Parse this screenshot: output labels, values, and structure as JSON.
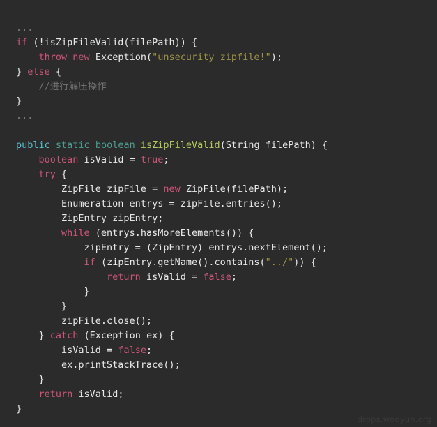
{
  "viewer": {
    "background_color": "#2b2b2b",
    "watermark": "drops.wooyun.org"
  },
  "theme": {
    "foreground": "#e8e8e8",
    "keyword": "#cc5577",
    "modifier_public": "#5bbfd0",
    "modifier_static": "#4d9e92",
    "type_keyword": "#4d9e92",
    "function_name": "#b5cc5f",
    "string": "#9e9246",
    "comment": "#6f6f6f"
  },
  "code": {
    "language": "java",
    "lines": [
      {
        "id": "l1",
        "text": "..."
      },
      {
        "id": "l2",
        "text": "if (!isZipFileValid(filePath)) {"
      },
      {
        "id": "l3",
        "text": "    throw new Exception(\"unsecurity zipfile!\");"
      },
      {
        "id": "l4",
        "text": "} else {"
      },
      {
        "id": "l5",
        "text": "    //进行解压操作"
      },
      {
        "id": "l6",
        "text": "}"
      },
      {
        "id": "l7",
        "text": "..."
      },
      {
        "id": "l8",
        "text": ""
      },
      {
        "id": "l9",
        "text": "public static boolean isZipFileValid(String filePath) {"
      },
      {
        "id": "l10",
        "text": "    boolean isValid = true;"
      },
      {
        "id": "l11",
        "text": "    try {"
      },
      {
        "id": "l12",
        "text": "        ZipFile zipFile = new ZipFile(filePath);"
      },
      {
        "id": "l13",
        "text": "        Enumeration entrys = zipFile.entries();"
      },
      {
        "id": "l14",
        "text": "        ZipEntry zipEntry;"
      },
      {
        "id": "l15",
        "text": "        while (entrys.hasMoreElements()) {"
      },
      {
        "id": "l16",
        "text": "            zipEntry = (ZipEntry) entrys.nextElement();"
      },
      {
        "id": "l17",
        "text": "            if (zipEntry.getName().contains(\"../\")) {"
      },
      {
        "id": "l18",
        "text": "                return isValid = false;"
      },
      {
        "id": "l19",
        "text": "            }"
      },
      {
        "id": "l20",
        "text": "        }"
      },
      {
        "id": "l21",
        "text": "        zipFile.close();"
      },
      {
        "id": "l22",
        "text": "    } catch (Exception ex) {"
      },
      {
        "id": "l23",
        "text": "        isValid = false;"
      },
      {
        "id": "l24",
        "text": "        ex.printStackTrace();"
      },
      {
        "id": "l25",
        "text": "    }"
      },
      {
        "id": "l26",
        "text": "    return isValid;"
      },
      {
        "id": "l27",
        "text": "}"
      }
    ],
    "tokens": {
      "l1": [
        {
          "t": "...",
          "c": "ellipsis"
        }
      ],
      "l2": [
        {
          "t": "if",
          "c": "kw"
        },
        {
          "t": " (!isZipFileValid(filePath)) {",
          "c": "plain"
        }
      ],
      "l3": [
        {
          "t": "    ",
          "c": "plain"
        },
        {
          "t": "throw",
          "c": "kw"
        },
        {
          "t": " ",
          "c": "plain"
        },
        {
          "t": "new",
          "c": "kw"
        },
        {
          "t": " Exception(",
          "c": "plain"
        },
        {
          "t": "\"unsecurity zipfile!\"",
          "c": "str"
        },
        {
          "t": ");",
          "c": "plain"
        }
      ],
      "l4": [
        {
          "t": "} ",
          "c": "plain"
        },
        {
          "t": "else",
          "c": "kw"
        },
        {
          "t": " {",
          "c": "plain"
        }
      ],
      "l5": [
        {
          "t": "    ",
          "c": "plain"
        },
        {
          "t": "//进行解压操作",
          "c": "cmt"
        }
      ],
      "l6": [
        {
          "t": "}",
          "c": "plain"
        }
      ],
      "l7": [
        {
          "t": "...",
          "c": "ellipsis"
        }
      ],
      "l8": [
        {
          "t": "",
          "c": "plain"
        }
      ],
      "l9": [
        {
          "t": "public",
          "c": "kw-mod"
        },
        {
          "t": " ",
          "c": "plain"
        },
        {
          "t": "static",
          "c": "kw-mod2"
        },
        {
          "t": " ",
          "c": "plain"
        },
        {
          "t": "boolean",
          "c": "kw-type"
        },
        {
          "t": " ",
          "c": "plain"
        },
        {
          "t": "isZipFileValid",
          "c": "fn"
        },
        {
          "t": "(String filePath) {",
          "c": "plain"
        }
      ],
      "l10": [
        {
          "t": "    ",
          "c": "plain"
        },
        {
          "t": "boolean",
          "c": "kw"
        },
        {
          "t": " isValid = ",
          "c": "plain"
        },
        {
          "t": "true",
          "c": "kw"
        },
        {
          "t": ";",
          "c": "plain"
        }
      ],
      "l11": [
        {
          "t": "    ",
          "c": "plain"
        },
        {
          "t": "try",
          "c": "kw"
        },
        {
          "t": " {",
          "c": "plain"
        }
      ],
      "l12": [
        {
          "t": "        ZipFile zipFile = ",
          "c": "plain"
        },
        {
          "t": "new",
          "c": "kw"
        },
        {
          "t": " ZipFile(filePath);",
          "c": "plain"
        }
      ],
      "l13": [
        {
          "t": "        Enumeration entrys = zipFile.entries();",
          "c": "plain"
        }
      ],
      "l14": [
        {
          "t": "        ZipEntry zipEntry;",
          "c": "plain"
        }
      ],
      "l15": [
        {
          "t": "        ",
          "c": "plain"
        },
        {
          "t": "while",
          "c": "kw"
        },
        {
          "t": " (entrys.hasMoreElements()) {",
          "c": "plain"
        }
      ],
      "l16": [
        {
          "t": "            zipEntry = (ZipEntry) entrys.nextElement();",
          "c": "plain"
        }
      ],
      "l17": [
        {
          "t": "            ",
          "c": "plain"
        },
        {
          "t": "if",
          "c": "kw"
        },
        {
          "t": " (zipEntry.getName().contains(",
          "c": "plain"
        },
        {
          "t": "\"../\"",
          "c": "str"
        },
        {
          "t": ")) {",
          "c": "plain"
        }
      ],
      "l18": [
        {
          "t": "                ",
          "c": "plain"
        },
        {
          "t": "return",
          "c": "kw"
        },
        {
          "t": " isValid = ",
          "c": "plain"
        },
        {
          "t": "false",
          "c": "kw"
        },
        {
          "t": ";",
          "c": "plain"
        }
      ],
      "l19": [
        {
          "t": "            }",
          "c": "plain"
        }
      ],
      "l20": [
        {
          "t": "        }",
          "c": "plain"
        }
      ],
      "l21": [
        {
          "t": "        zipFile.close();",
          "c": "plain"
        }
      ],
      "l22": [
        {
          "t": "    } ",
          "c": "plain"
        },
        {
          "t": "catch",
          "c": "kw"
        },
        {
          "t": " (Exception ex) {",
          "c": "plain"
        }
      ],
      "l23": [
        {
          "t": "        isValid = ",
          "c": "plain"
        },
        {
          "t": "false",
          "c": "kw"
        },
        {
          "t": ";",
          "c": "plain"
        }
      ],
      "l24": [
        {
          "t": "        ex.printStackTrace();",
          "c": "plain"
        }
      ],
      "l25": [
        {
          "t": "    }",
          "c": "plain"
        }
      ],
      "l26": [
        {
          "t": "    ",
          "c": "plain"
        },
        {
          "t": "return",
          "c": "kw"
        },
        {
          "t": " isValid;",
          "c": "plain"
        }
      ],
      "l27": [
        {
          "t": "}",
          "c": "plain"
        }
      ]
    }
  }
}
